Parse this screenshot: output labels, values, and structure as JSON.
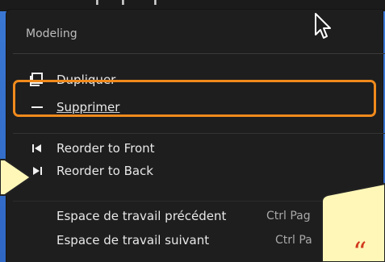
{
  "menu": {
    "title": "Modeling",
    "items": [
      {
        "icon": "duplicate-icon",
        "label": "Dupliquer"
      },
      {
        "icon": "minus-icon",
        "label": "Supprimer",
        "highlighted": true
      },
      {
        "icon": "reorder-front-icon",
        "label": "Reorder to Front"
      },
      {
        "icon": "reorder-back-icon",
        "label": "Reorder to Back"
      },
      {
        "label": "Espace de travail précédent",
        "shortcut": "Ctrl Pag"
      },
      {
        "label": "Espace de travail suivant",
        "shortcut": "Ctrl Pa"
      }
    ]
  },
  "overlay": {
    "quote_glyph": "“"
  },
  "colors": {
    "highlight": "#f08a1c",
    "menu_bg": "#1e1e1e",
    "callout_fill": "#fff7b8",
    "backdrop": "#2f6fd0"
  }
}
